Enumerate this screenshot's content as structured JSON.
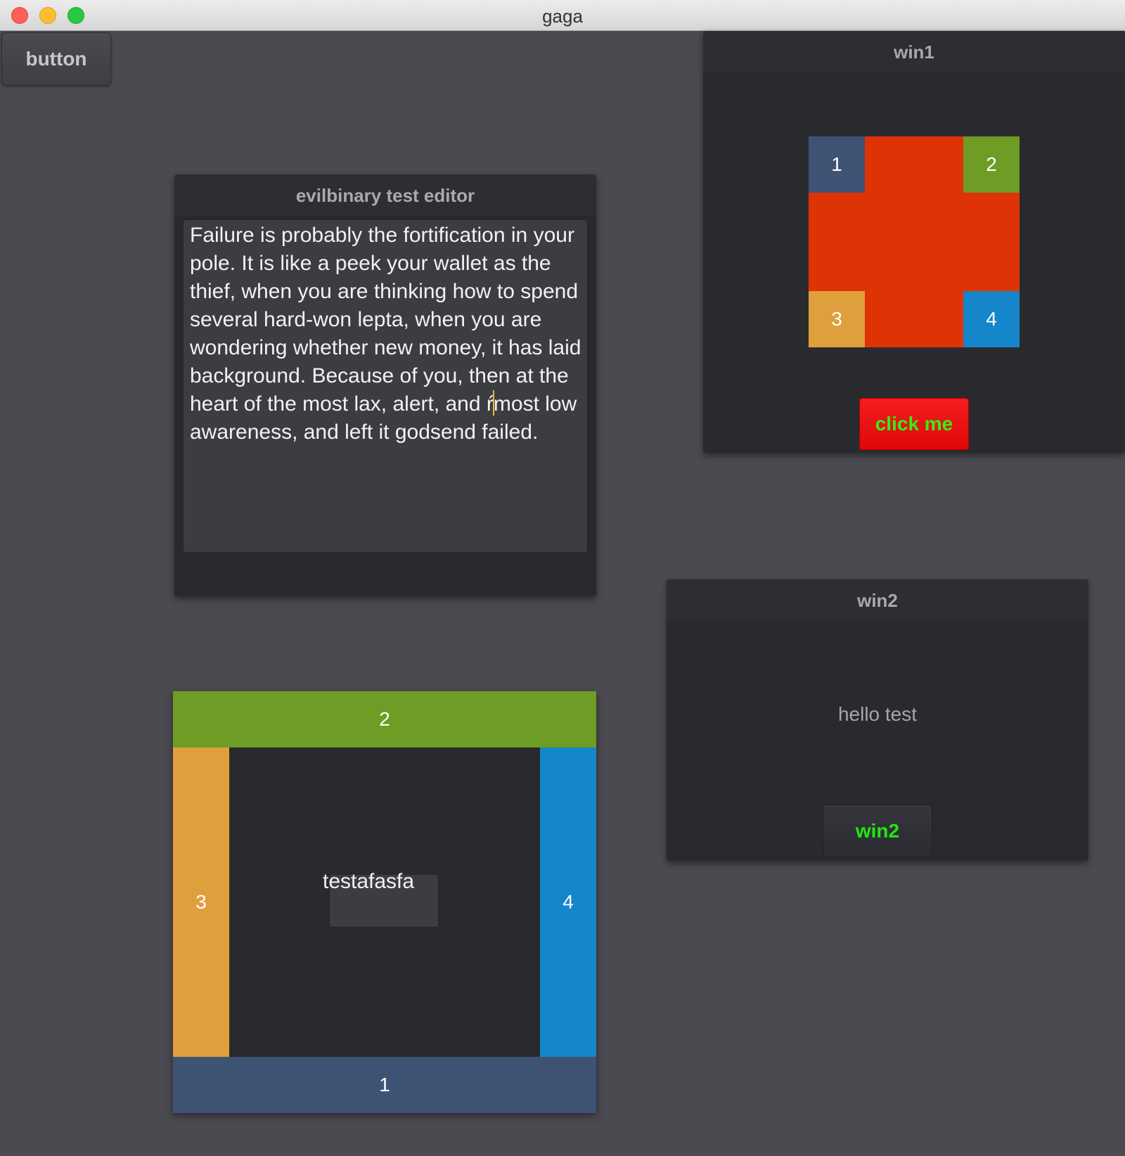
{
  "window": {
    "title": "gaga"
  },
  "toolbar": {
    "button_label": "button"
  },
  "editor": {
    "title": "evilbinary test editor",
    "text_before_caret": "Failure is probably the fortification in your pole. It is like a peek your wallet as the thief, when you are thinking how to spend several hard-won lepta, when you are wondering whether new money, it has laid background. Because of you, then at the heart of the most lax, alert, and ŕ",
    "text_after_caret": "most low awareness, and left it godsend failed."
  },
  "win1": {
    "title": "win1",
    "cells": [
      "1",
      "2",
      "3",
      "4"
    ],
    "button_label": "click me",
    "colors": {
      "center": "#df3306",
      "cell1": "#3e5374",
      "cell2": "#6f9c24",
      "cell3": "#df9f3c",
      "cell4": "#1486c9",
      "button_bg": "#f51d1d",
      "button_text": "#2ef214"
    }
  },
  "win2": {
    "title": "win2",
    "label": "hello test",
    "button_label": "win2"
  },
  "border_layout": {
    "top": "2",
    "left": "3",
    "right": "4",
    "bottom": "1",
    "center_text": "testafasfa"
  }
}
